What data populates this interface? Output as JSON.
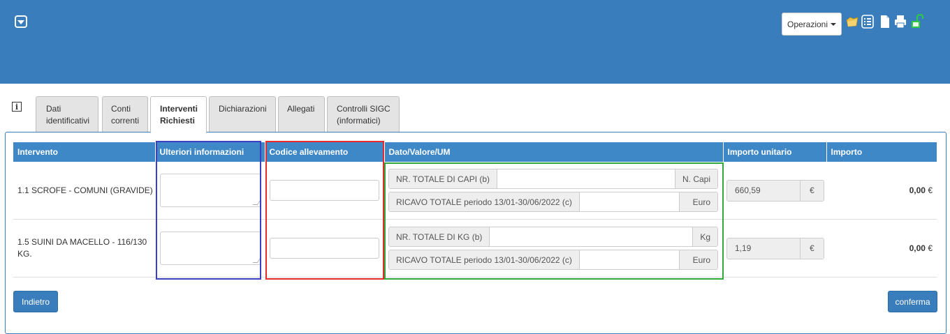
{
  "header": {
    "operations_label": "Operazioni",
    "icons": [
      "folder-icon",
      "checklist-icon",
      "document-icon",
      "print-icon",
      "unlock-icon"
    ]
  },
  "tabs": [
    {
      "line1": "Dati",
      "line2": "identificativi",
      "active": false
    },
    {
      "line1": "Conti",
      "line2": "correnti",
      "active": false
    },
    {
      "line1": "Interventi",
      "line2": "Richiesti",
      "active": true
    },
    {
      "line1": "Dichiarazioni",
      "line2": "",
      "active": false
    },
    {
      "line1": "Allegati",
      "line2": "",
      "active": false
    },
    {
      "line1": "Controlli SIGC",
      "line2": "(informatici)",
      "active": false
    }
  ],
  "table": {
    "headers": {
      "intervento": "Intervento",
      "ulteriori": "Ulteriori informazioni",
      "codice": "Codice allevamento",
      "dato": "Dato/Valore/UM",
      "importo_unitario": "Importo unitario",
      "importo": "Importo"
    },
    "rows": [
      {
        "intervento": "1.1 SCROFE - COMUNI (GRAVIDE)",
        "ulteriori_value": "",
        "codice_value": "",
        "dato1_label": "NR. TOTALE DI CAPI (b)",
        "dato1_value": "",
        "dato1_unit": "N. Capi",
        "dato2_label": "RICAVO TOTALE periodo 13/01-30/06/2022 (c)",
        "dato2_value": "",
        "dato2_unit": "Euro",
        "importo_unitario": "660,59",
        "importo_unitario_currency": "€",
        "importo_value": "0,00",
        "importo_currency": "€"
      },
      {
        "intervento": "1.5 SUINI DA MACELLO - 116/130 KG.",
        "ulteriori_value": "",
        "codice_value": "",
        "dato1_label": "NR. TOTALE DI KG (b)",
        "dato1_value": "",
        "dato1_unit": "Kg",
        "dato2_label": "RICAVO TOTALE periodo 13/01-30/06/2022 (c)",
        "dato2_value": "",
        "dato2_unit": "Euro",
        "importo_unitario": "1,19",
        "importo_unitario_currency": "€",
        "importo_value": "0,00",
        "importo_currency": "€"
      }
    ]
  },
  "buttons": {
    "back_label": "Indietro",
    "confirm_label": "conferma"
  },
  "colors": {
    "header_bg": "#3a7dbd",
    "table_header_bg": "#3f88c8",
    "highlight_blue": "#3b3fc4",
    "highlight_red": "#e52b2b",
    "highlight_green": "#2eaa3c"
  }
}
